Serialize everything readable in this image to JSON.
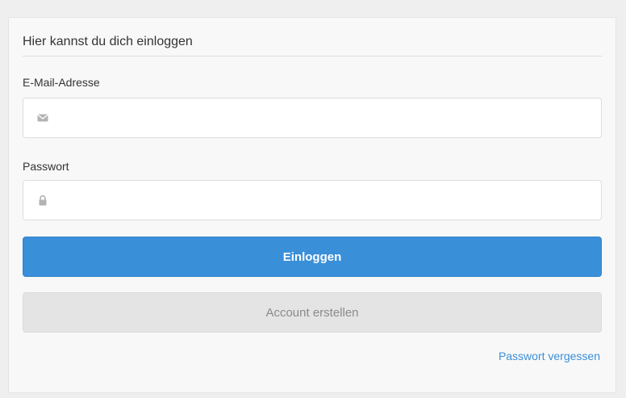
{
  "login_card": {
    "title": "Hier kannst du dich einloggen",
    "email": {
      "label": "E-Mail-Adresse",
      "value": "",
      "placeholder": "",
      "icon": "envelope-icon"
    },
    "password": {
      "label": "Passwort",
      "value": "",
      "placeholder": "",
      "icon": "lock-icon"
    },
    "login_button_label": "Einloggen",
    "create_account_label": "Account erstellen",
    "forgot_password_label": "Passwort vergessen"
  },
  "colors": {
    "primary": "#3a8fd9",
    "secondary_button_bg": "#e4e4e4",
    "icon_gray": "#b3b3b3"
  }
}
